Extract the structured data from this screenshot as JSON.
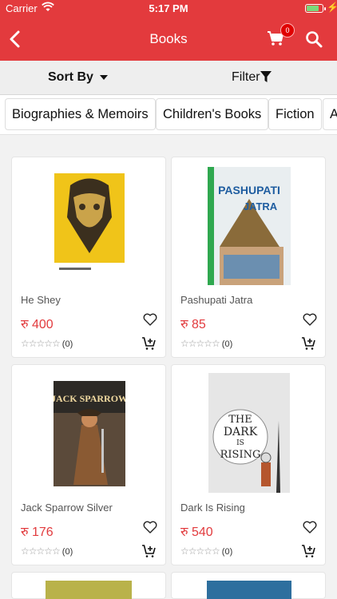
{
  "status_bar": {
    "carrier": "Carrier",
    "time": "5:17 PM"
  },
  "nav": {
    "title": "Books",
    "cart_count": "0",
    "back_icon": "chevron-left-icon",
    "cart_icon": "cart-icon",
    "search_icon": "search-icon"
  },
  "toolbar": {
    "sort_label": "Sort By",
    "filter_label": "Filter"
  },
  "categories": [
    "Biographies & Memoirs",
    "Children's Books",
    "Fiction",
    "A"
  ],
  "currency": "रु",
  "products": [
    {
      "title": "He Shey",
      "price": "रु 400",
      "rating_count": "(0)"
    },
    {
      "title": "Pashupati Jatra",
      "price": "रु 85",
      "rating_count": "(0)"
    },
    {
      "title": "Jack Sparrow Silver",
      "price": "रु 176",
      "rating_count": "(0)"
    },
    {
      "title": "Dark Is Rising",
      "price": "रु 540",
      "rating_count": "(0)"
    }
  ],
  "colors": {
    "header": "#e33a3d",
    "price": "#e23b3e",
    "badge": "#e00000"
  }
}
